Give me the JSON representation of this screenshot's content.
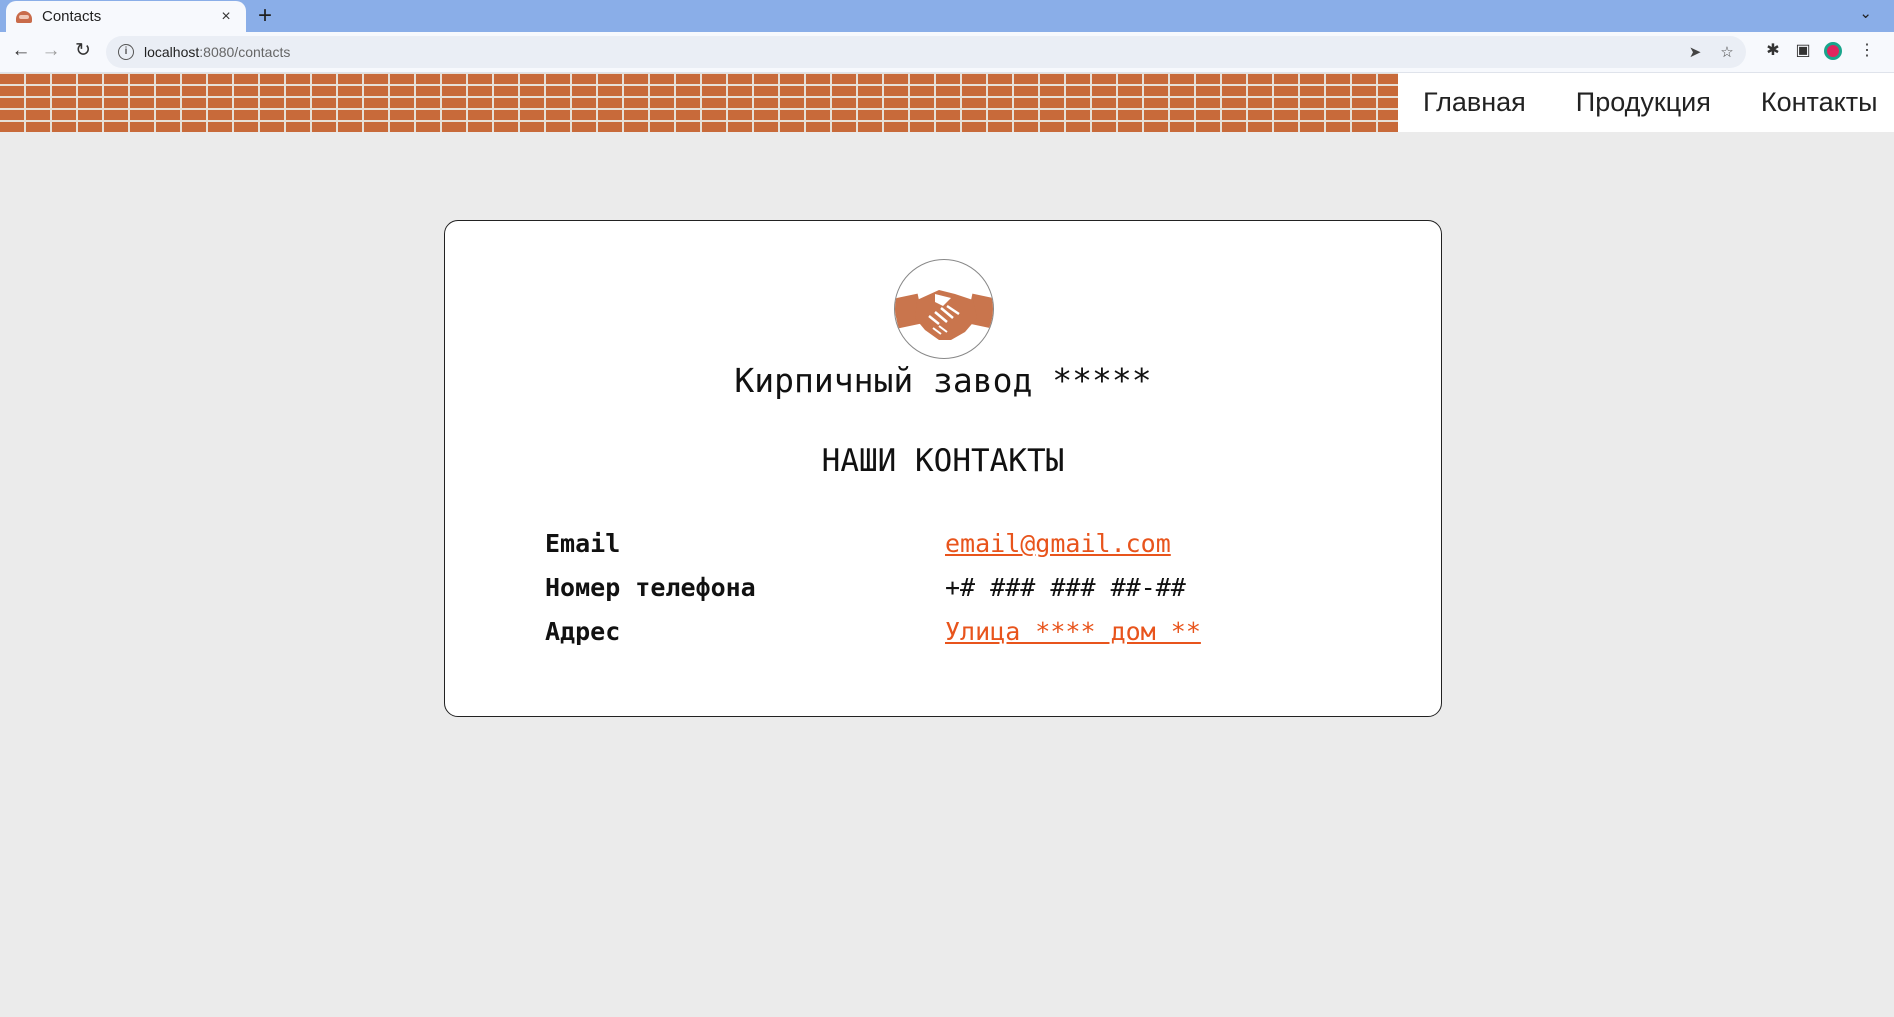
{
  "browser": {
    "tab_title": "Contacts",
    "close_icon": "×",
    "new_tab_icon": "+",
    "tab_menu_icon": "⌄",
    "url_host": "localhost",
    "url_path": ":8080/contacts",
    "back_icon": "←",
    "forward_icon": "→",
    "reload_icon": "↻",
    "send_icon": "➤",
    "star_icon": "☆",
    "extensions_icon": "✱",
    "sidepanel_icon": "▣",
    "menu_icon": "⋮"
  },
  "nav": {
    "items": [
      {
        "label": "Главная"
      },
      {
        "label": "Продукция"
      },
      {
        "label": "Контакты"
      }
    ]
  },
  "card": {
    "company": "Кирпичный завод *****",
    "section_title": "НАШИ КОНТАКТЫ",
    "rows": [
      {
        "label": "Email",
        "value": "email@gmail.com"
      },
      {
        "label": "Номер телефона",
        "value": "+# ### ### ##-##"
      },
      {
        "label": "Адрес",
        "value": "Улица **** дом **"
      }
    ]
  },
  "colors": {
    "link": "#e8541c",
    "brick": "#c86a3a",
    "tabstrip": "#8aaee8"
  }
}
